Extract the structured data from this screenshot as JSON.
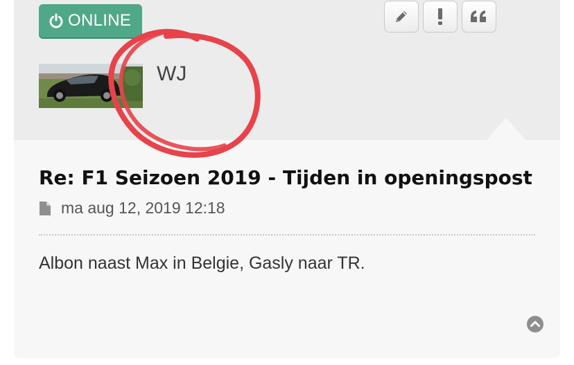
{
  "badge": {
    "status_label": "ONLINE",
    "icon": "power-icon",
    "color": "#4fa888"
  },
  "actions": [
    {
      "name": "edit-button",
      "icon": "pencil-icon"
    },
    {
      "name": "report-button",
      "icon": "exclamation-icon"
    },
    {
      "name": "quote-button",
      "icon": "quote-icon"
    }
  ],
  "author": {
    "username": "WJ",
    "avatar": "avatar-photo"
  },
  "annotation": {
    "shape": "hand-drawn circle around username",
    "color": "#e8424a"
  },
  "post": {
    "title": "Re: F1 Seizoen 2019 - Tijden in openingspost",
    "date": "ma aug 12, 2019 12:18",
    "date_icon": "document-icon",
    "content": "Albon naast Max in Belgie, Gasly naar TR."
  },
  "back_to_top_icon": "chevron-up-circle-icon"
}
